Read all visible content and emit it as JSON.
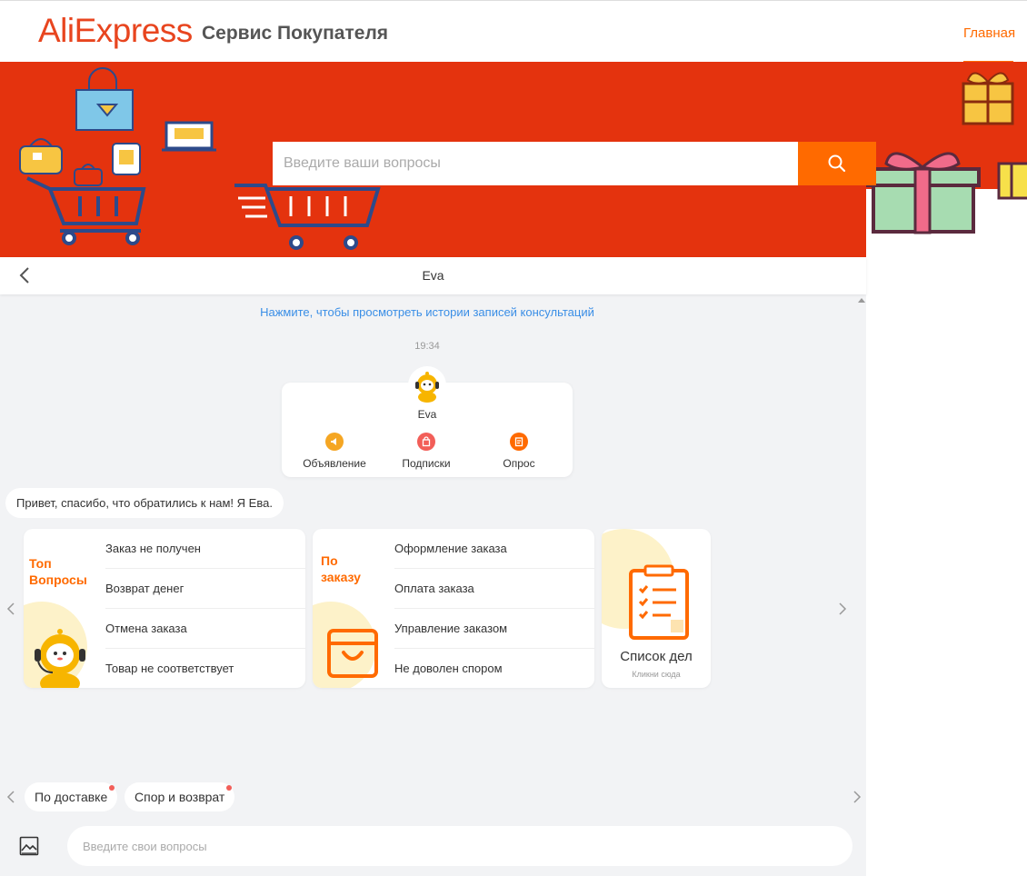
{
  "header": {
    "logo": "AliExpress",
    "service_title": "Сервис Покупателя",
    "nav_home": "Главная"
  },
  "search": {
    "placeholder": "Введите ваши вопросы",
    "icon": "search-icon"
  },
  "chat": {
    "title": "Eva",
    "history_link": "Нажмите, чтобы просмотреть истории записей консультаций",
    "timestamp": "19:34",
    "bot_name": "Eva",
    "quick_actions": [
      {
        "label": "Объявление",
        "icon": "megaphone-icon",
        "color": "#f5a623"
      },
      {
        "label": "Подписки",
        "icon": "bag-icon",
        "color": "#f25e58"
      },
      {
        "label": "Опрос",
        "icon": "survey-icon",
        "color": "#ff6a00"
      }
    ],
    "greeting": "Привет, спасибо, что обратились к нам! Я Ева."
  },
  "cards": [
    {
      "title_line1": "Топ",
      "title_line2": "Вопросы",
      "items": [
        "Заказ не получен",
        "Возврат денег",
        "Отмена заказа",
        "Товар не соответствует"
      ]
    },
    {
      "title_line1": "По",
      "title_line2": "заказу",
      "items": [
        "Оформление заказа",
        "Оплата заказа",
        "Управление заказом",
        "Не доволен спором"
      ]
    },
    {
      "title": "Список дел",
      "subtitle": "Кликни сюда"
    }
  ],
  "chips": [
    "По доставке",
    "Спор и возврат"
  ],
  "input": {
    "placeholder": "Введите свои вопросы"
  },
  "colors": {
    "brand": "#e8451f",
    "banner": "#e4330e",
    "accent": "#ff6a00",
    "link": "#3a8ee6"
  }
}
